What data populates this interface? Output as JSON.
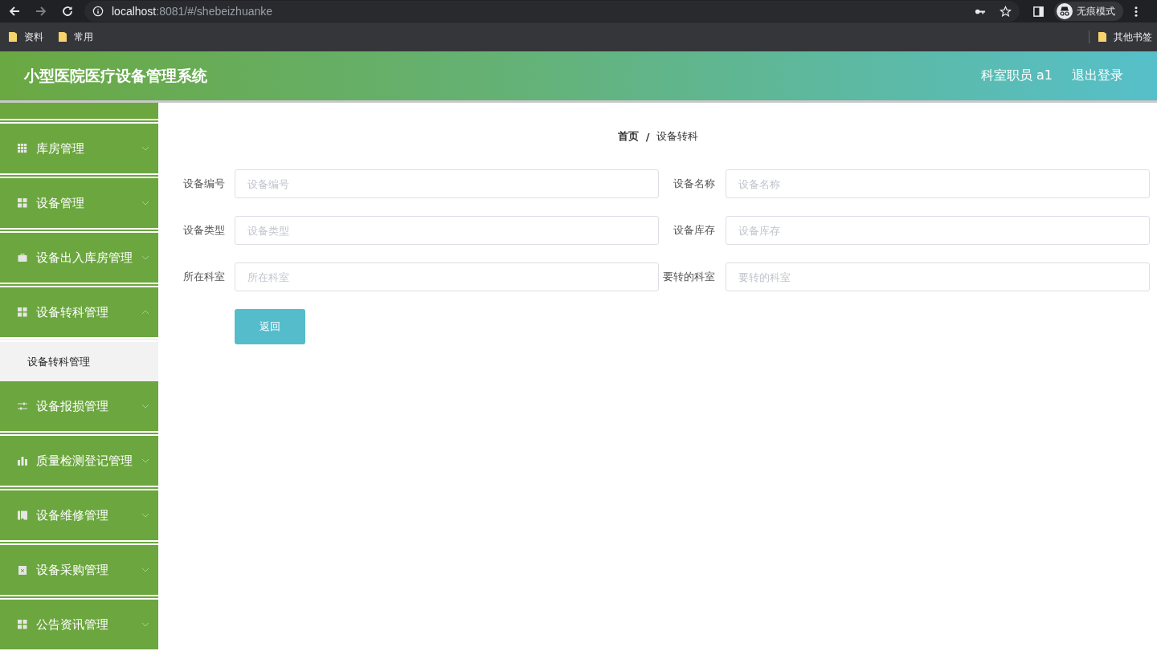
{
  "browser": {
    "url_host": "localhost",
    "url_path": ":8081/#/shebeizhuanke",
    "profile": "无痕模式",
    "bookmarks": [
      {
        "label": "资料"
      },
      {
        "label": "常用"
      }
    ],
    "other_bookmarks": "其他书签"
  },
  "header": {
    "title": "小型医院医疗设备管理系统",
    "user": "科室职员 a1",
    "logout": "退出登录"
  },
  "sidebar": {
    "items": [
      {
        "kind": "partial"
      },
      {
        "label": "库房管理",
        "expanded": false
      },
      {
        "label": "设备管理",
        "expanded": false
      },
      {
        "label": "设备出入库房管理",
        "expanded": false
      },
      {
        "label": "设备转科管理",
        "expanded": true,
        "children": [
          {
            "label": "设备转科管理"
          }
        ]
      },
      {
        "label": "设备报损管理",
        "expanded": false
      },
      {
        "label": "质量检测登记管理",
        "expanded": false
      },
      {
        "label": "设备维修管理",
        "expanded": false
      },
      {
        "label": "设备采购管理",
        "expanded": false
      },
      {
        "label": "公告资讯管理",
        "expanded": false
      }
    ]
  },
  "breadcrumb": {
    "separator": "/",
    "items": [
      {
        "label": "首页"
      },
      {
        "label": "设备转科"
      }
    ]
  },
  "form": {
    "fields": [
      {
        "label": "设备编号",
        "placeholder": "设备编号"
      },
      {
        "label": "设备名称",
        "placeholder": "设备名称"
      },
      {
        "label": "设备类型",
        "placeholder": "设备类型"
      },
      {
        "label": "设备库存",
        "placeholder": "设备库存"
      },
      {
        "label": "所在科室",
        "placeholder": "所在科室"
      },
      {
        "label": "要转的科室",
        "placeholder": "要转的科室"
      }
    ],
    "button": "返回"
  }
}
